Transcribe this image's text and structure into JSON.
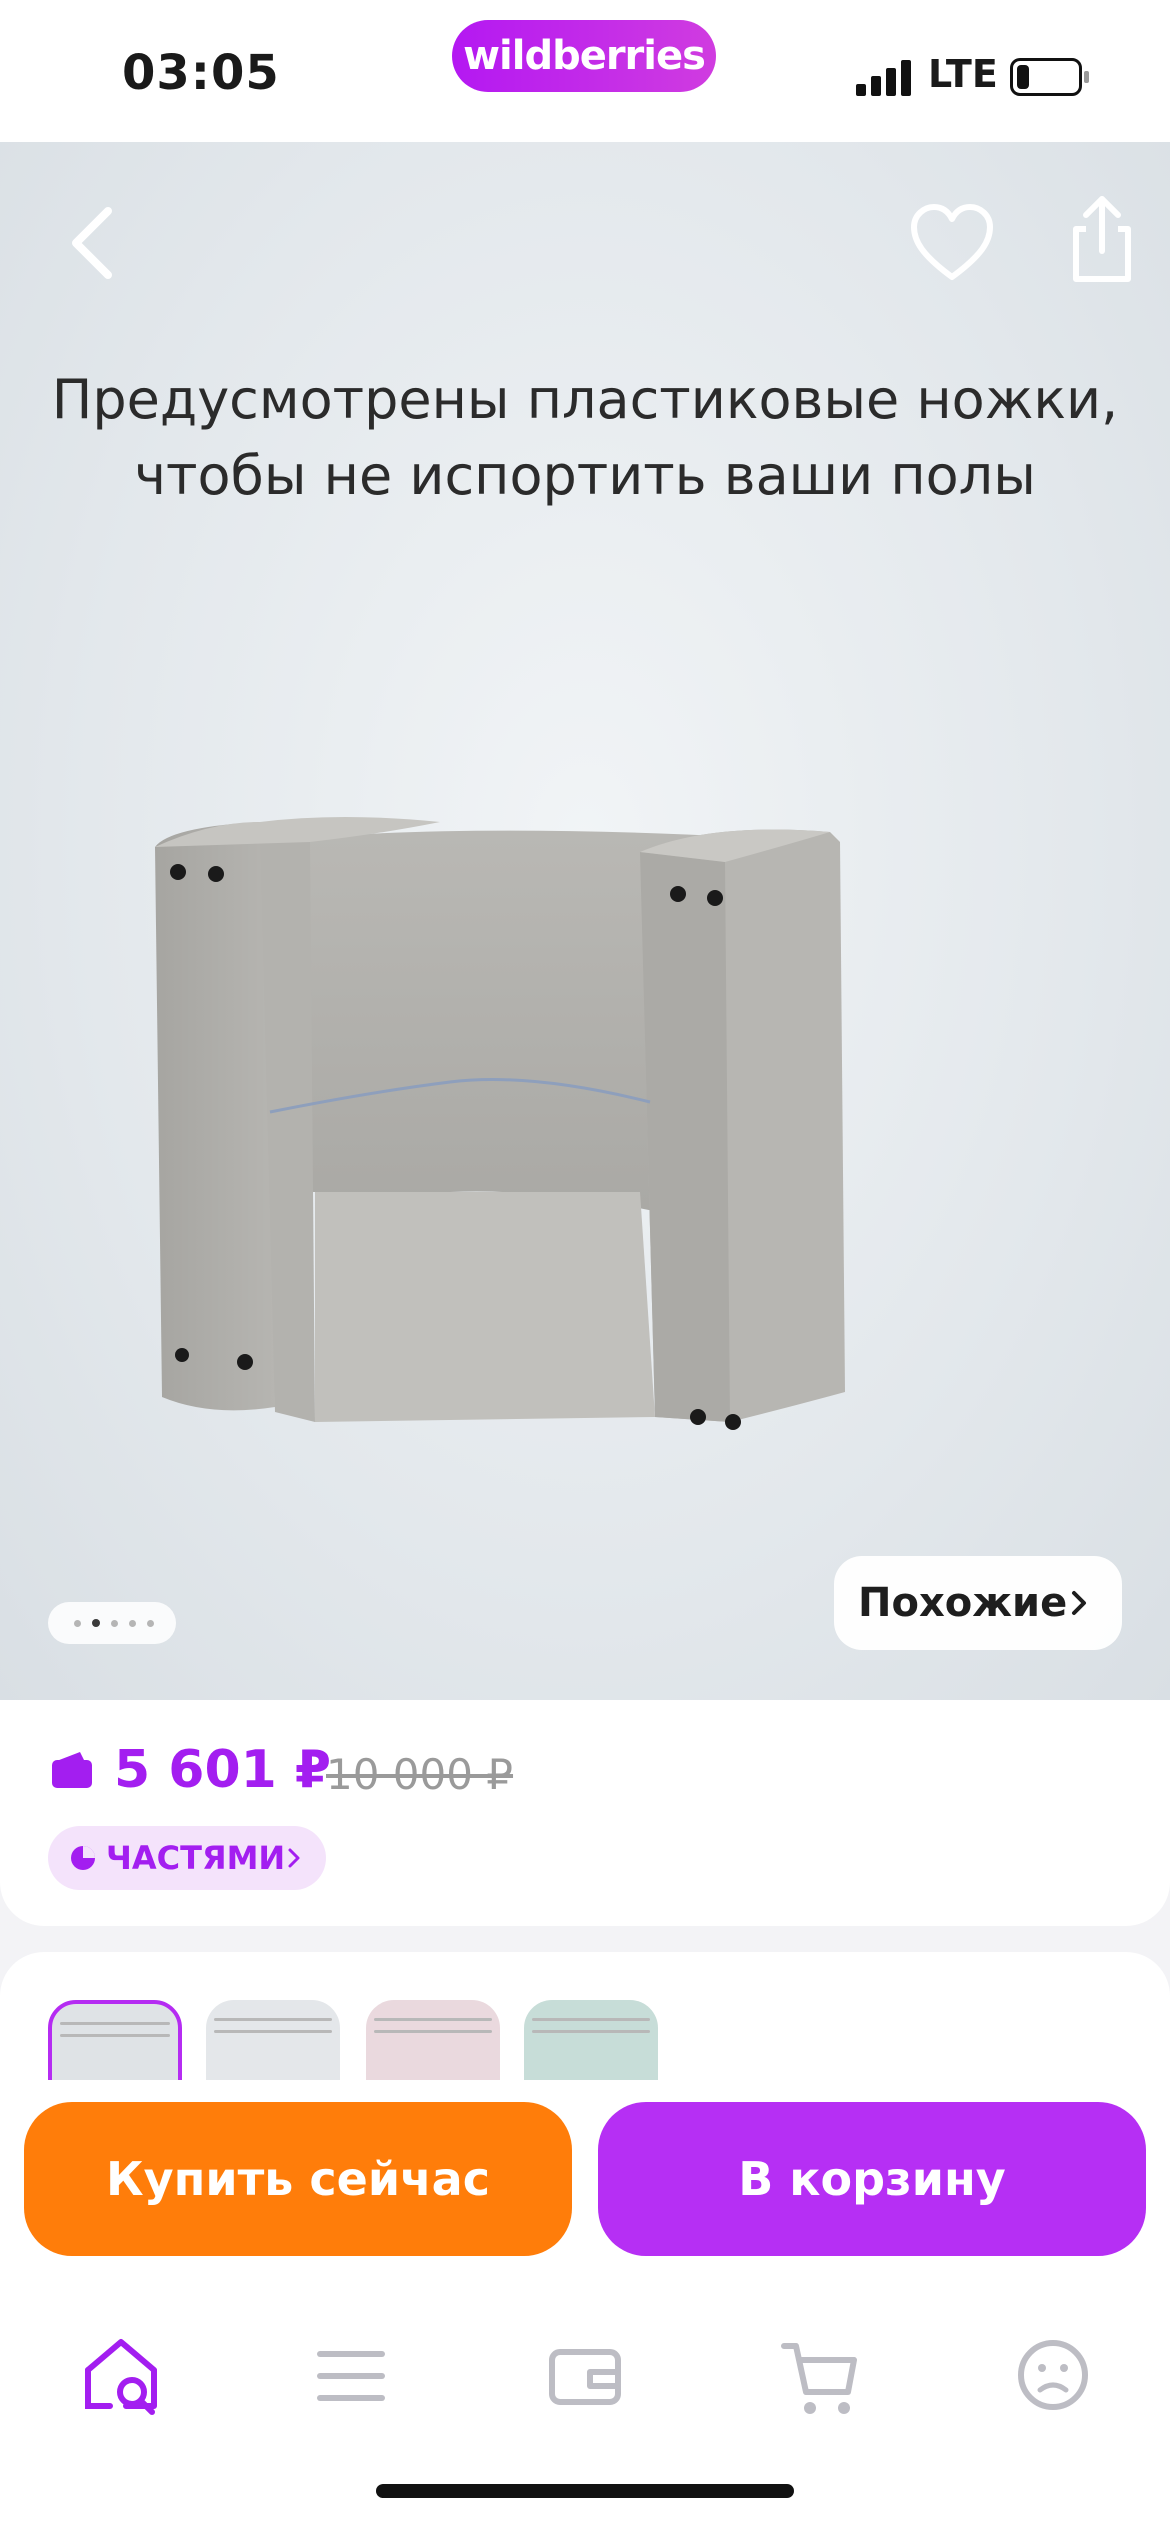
{
  "status_bar": {
    "time": "03:05",
    "network": "LTE",
    "brand": "wildberries"
  },
  "hero": {
    "caption_line1": "Предусмотрены пластиковые ножки,",
    "caption_line2": "чтобы не испортить ваши полы",
    "similar_label": "Похожие",
    "gallery_total": 5,
    "gallery_active_index": 1
  },
  "price": {
    "current": "5 601 ₽",
    "old": "10 000 ₽",
    "installments_label": "ЧАСТЯМИ",
    "accent_color": "#a31ef0"
  },
  "variants": {
    "thumbnails": [
      {
        "name": "variant-1",
        "selected": true,
        "tint": "#dfe3e6"
      },
      {
        "name": "variant-2",
        "selected": false,
        "tint": "#e4e7ea"
      },
      {
        "name": "variant-3",
        "selected": false,
        "tint": "#ead9de"
      },
      {
        "name": "variant-4",
        "selected": false,
        "tint": "#c7ddd8"
      }
    ]
  },
  "actions": {
    "buy_now": "Купить сейчас",
    "add_to_cart": "В корзину",
    "buy_color": "#ff7d0a",
    "cart_color": "#b62ff4"
  },
  "tabbar": {
    "items": [
      {
        "icon": "home-search-icon",
        "active": true
      },
      {
        "icon": "menu-icon",
        "active": false
      },
      {
        "icon": "wallet-icon",
        "active": false
      },
      {
        "icon": "cart-icon",
        "active": false
      },
      {
        "icon": "profile-icon",
        "active": false
      }
    ],
    "active_color": "#a31ef0",
    "inactive_color": "#bdbdc4"
  }
}
